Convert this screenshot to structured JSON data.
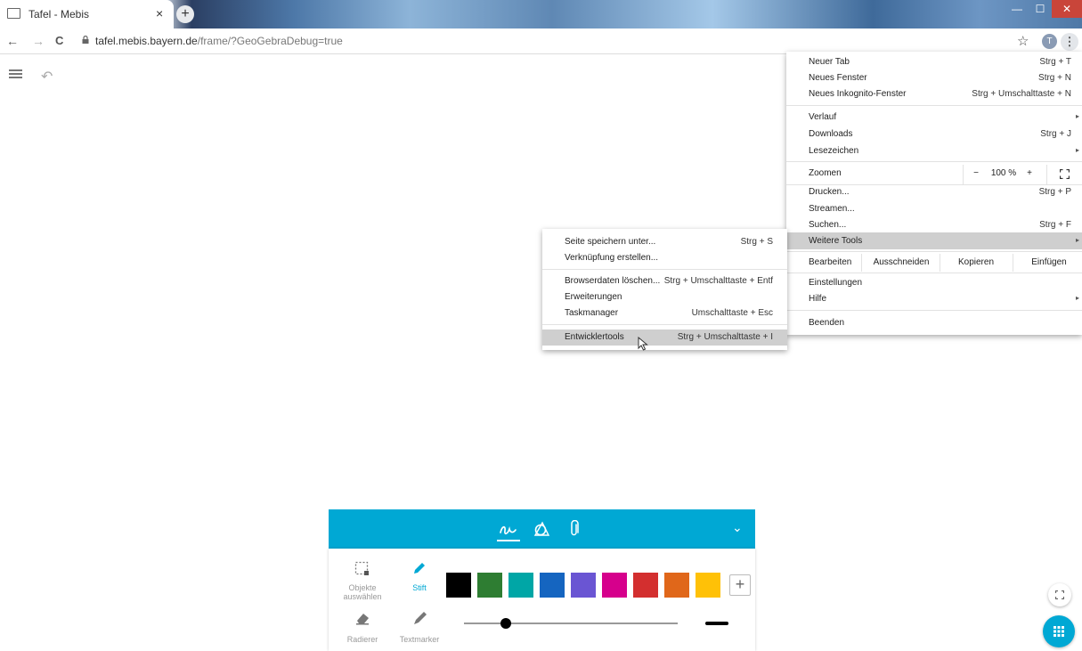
{
  "tab": {
    "title": "Tafel - Mebis",
    "close": "×",
    "newtab": "+"
  },
  "window": {
    "min": "—",
    "max": "☐",
    "close": "✕"
  },
  "nav": {
    "back": "←",
    "forward": "→",
    "reload": "C"
  },
  "address": {
    "host": "tafel.mebis.bayern.de",
    "path": "/frame/?GeoGebraDebug=true"
  },
  "profile": {
    "initial": "T",
    "menu": "⋮",
    "star": "☆"
  },
  "app": {
    "undo": "↶"
  },
  "menu": {
    "items": [
      {
        "label": "Neuer Tab",
        "shortcut": "Strg + T"
      },
      {
        "label": "Neues Fenster",
        "shortcut": "Strg + N"
      },
      {
        "label": "Neues Inkognito-Fenster",
        "shortcut": "Strg + Umschalttaste + N"
      },
      {
        "label": "Verlauf",
        "arrow": "▸"
      },
      {
        "label": "Downloads",
        "shortcut": "Strg + J"
      },
      {
        "label": "Lesezeichen",
        "arrow": "▸"
      },
      {
        "label": "Drucken...",
        "shortcut": "Strg + P"
      },
      {
        "label": "Streamen..."
      },
      {
        "label": "Suchen...",
        "shortcut": "Strg + F"
      },
      {
        "label": "Weitere Tools",
        "arrow": "▸"
      },
      {
        "label": "Einstellungen"
      },
      {
        "label": "Hilfe",
        "arrow": "▸"
      },
      {
        "label": "Beenden"
      }
    ],
    "zoom": {
      "label": "Zoomen",
      "minus": "−",
      "value": "100 %",
      "plus": "+"
    },
    "edit": {
      "label": "Bearbeiten",
      "cut": "Ausschneiden",
      "copy": "Kopieren",
      "paste": "Einfügen"
    }
  },
  "submenu": {
    "items": [
      {
        "label": "Seite speichern unter...",
        "shortcut": "Strg + S"
      },
      {
        "label": "Verknüpfung erstellen..."
      },
      {
        "label": "Browserdaten löschen...",
        "shortcut": "Strg + Umschalttaste + Entf"
      },
      {
        "label": "Erweiterungen"
      },
      {
        "label": "Taskmanager",
        "shortcut": "Umschalttaste + Esc"
      },
      {
        "label": "Entwicklertools",
        "shortcut": "Strg + Umschalttaste + I"
      }
    ]
  },
  "toolbox": {
    "select_label_1": "Objekte",
    "select_label_2": "auswählen",
    "pen_label": "Stift",
    "eraser_label": "Radierer",
    "highlighter_label": "Textmarker",
    "add_color": "+",
    "collapse": "⌄",
    "colors": [
      "#000000",
      "#2e7d32",
      "#00a6a6",
      "#1565c0",
      "#6a55d3",
      "#d6008c",
      "#d32f2f",
      "#e0671a",
      "#ffc107"
    ],
    "pen_size": 0.07
  }
}
